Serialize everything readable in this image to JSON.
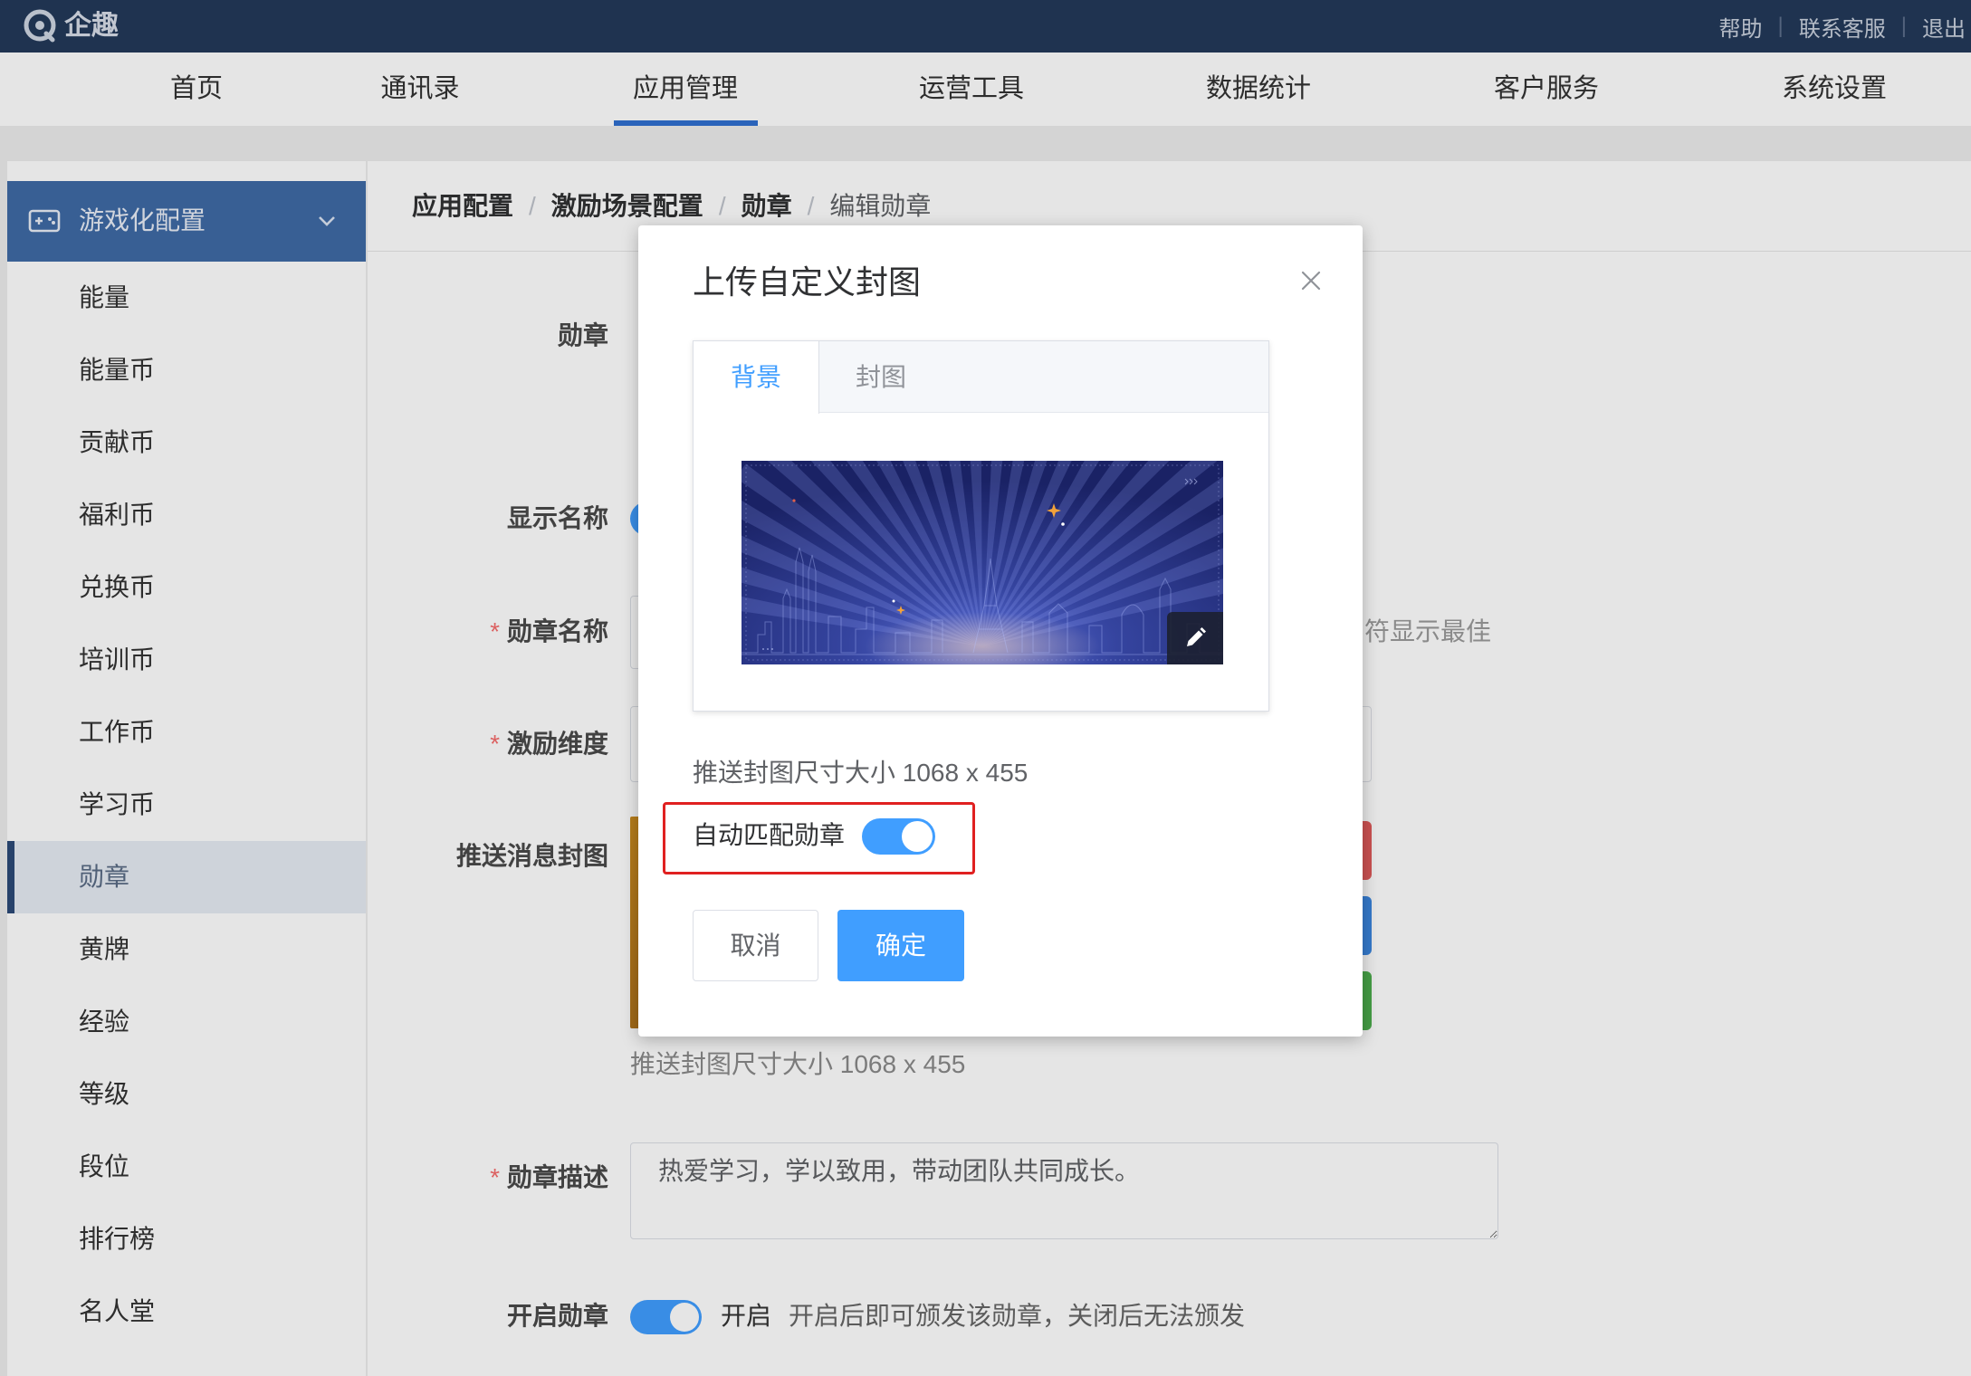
{
  "topbar": {
    "logo_text": "企趣",
    "links": [
      "帮助",
      "联系客服",
      "退出"
    ],
    "separator": "|"
  },
  "nav": {
    "items": [
      "首页",
      "通讯录",
      "应用管理",
      "运营工具",
      "数据统计",
      "客户服务",
      "系统设置"
    ],
    "active_index": 2
  },
  "sidebar": {
    "group_title": "游戏化配置",
    "items": [
      "能量",
      "能量币",
      "贡献币",
      "福利币",
      "兑换币",
      "培训币",
      "工作币",
      "学习币",
      "勋章",
      "黄牌",
      "经验",
      "等级",
      "段位",
      "排行榜",
      "名人堂"
    ],
    "active_index": 8
  },
  "breadcrumb": {
    "items": [
      "应用配置",
      "激励场景配置",
      "勋章",
      "编辑勋章"
    ],
    "separator": "/"
  },
  "form": {
    "required_mark": "*",
    "badge_label": "勋章",
    "display_name_label": "显示名称",
    "display_name_enabled": true,
    "badge_name_label": "勋章名称",
    "badge_name_hint": "符显示最佳",
    "dimension_label": "激励维度",
    "cover_label": "推送消息封图",
    "cover_size_hint": "推送封图尺寸大小 1068 x 455",
    "description_label": "勋章描述",
    "description_value": "热爱学习，学以致用，带动团队共同成长。",
    "enable_label": "开启勋章",
    "enable_on": true,
    "enable_state_text": "开启",
    "enable_hint": "开启后即可颁发该勋章，关闭后无法颁发"
  },
  "modal": {
    "title": "上传自定义封图",
    "tabs": [
      "背景",
      "封图"
    ],
    "active_tab_index": 0,
    "size_hint": "推送封图尺寸大小 1068 x 455",
    "auto_match_label": "自动匹配勋章",
    "auto_match_on": true,
    "cancel_label": "取消",
    "confirm_label": "确定"
  },
  "icons": {
    "logo": "logo-icon",
    "sidebar_group": "gamepad-icon",
    "sidebar_expand": "chevron-down-icon",
    "modal_close": "close-icon",
    "cover_edit": "pencil-icon"
  },
  "colors": {
    "accent": "#409eff",
    "highlight": "#e02020",
    "topbar": "#23395a",
    "sidebar_header": "#3f6aa5",
    "nav_active": "#2f6fd0",
    "sidebar_active_bar": "#2c4a78",
    "required": "#f56c6c"
  }
}
